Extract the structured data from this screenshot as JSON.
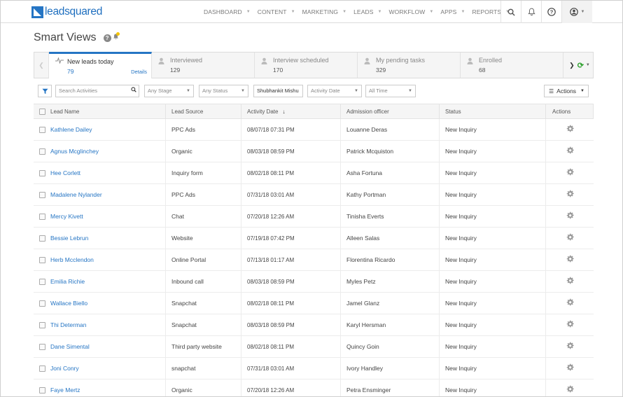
{
  "brand": {
    "logo_text": "leadsquared"
  },
  "nav": {
    "items": [
      "DASHBOARD",
      "CONTENT",
      "MARKETING",
      "LEADS",
      "WORKFLOW",
      "APPS",
      "REPORTS"
    ]
  },
  "page": {
    "title": "Smart Views"
  },
  "tabs": [
    {
      "label": "New leads today",
      "count": "79",
      "details": "Details",
      "active": true
    },
    {
      "label": "Interviewed",
      "count": "129"
    },
    {
      "label": "Interview scheduled",
      "count": "170"
    },
    {
      "label": "My pending tasks",
      "count": "329"
    },
    {
      "label": "Enrolled",
      "count": "68"
    }
  ],
  "filters": {
    "search_placeholder": "Search Activities",
    "stage": "Any Stage",
    "status": "Any Status",
    "owner": "Shubhankit Mishu",
    "date_field": "Activity Date",
    "time_range": "All Time",
    "actions_label": "Actions"
  },
  "table": {
    "columns": [
      "Lead Name",
      "Lead Source",
      "Activity Date",
      "Admission officer",
      "Status",
      "Actions"
    ],
    "rows": [
      {
        "name": "Kathlene Dailey",
        "source": "PPC Ads",
        "date": "08/07/18 07:31 PM",
        "officer": "Louanne Deras",
        "status": "New Inquiry"
      },
      {
        "name": "Agnus Mcglinchey",
        "source": "Organic",
        "date": "08/03/18 08:59 PM",
        "officer": "Patrick Mcquiston",
        "status": "New Inquiry"
      },
      {
        "name": "Hee Corlett",
        "source": "Inquiry form",
        "date": "08/02/18 08:11 PM",
        "officer": "Asha Fortuna",
        "status": "New Inquiry"
      },
      {
        "name": "Madalene Nylander",
        "source": "PPC Ads",
        "date": "07/31/18 03:01 AM",
        "officer": "Kathy Portman",
        "status": "New Inquiry"
      },
      {
        "name": "Mercy Kivett",
        "source": "Chat",
        "date": "07/20/18 12:26 AM",
        "officer": "Tinisha Everts",
        "status": "New Inquiry"
      },
      {
        "name": "Bessie Lebrun",
        "source": "Website",
        "date": "07/19/18 07:42 PM",
        "officer": "Alleen Salas",
        "status": "New Inquiry"
      },
      {
        "name": "Herb Mcclendon",
        "source": "Online Portal",
        "date": "07/13/18 01:17 AM",
        "officer": "Florentina Ricardo",
        "status": "New Inquiry"
      },
      {
        "name": "Emilia Richie",
        "source": "Inbound call",
        "date": "08/03/18 08:59 PM",
        "officer": "Myles Petz",
        "status": "New Inquiry"
      },
      {
        "name": "Wallace Biello",
        "source": "Snapchat",
        "date": "08/02/18 08:11 PM",
        "officer": "Jamel Glanz",
        "status": "New Inquiry"
      },
      {
        "name": "Thi Determan",
        "source": "Snapchat",
        "date": "08/03/18 08:59 PM",
        "officer": "Karyl Hersman",
        "status": "New Inquiry"
      },
      {
        "name": "Dane Simental",
        "source": "Third party website",
        "date": "08/02/18 08:11 PM",
        "officer": "Quincy Goin",
        "status": "New Inquiry"
      },
      {
        "name": "Joni Conry",
        "source": "snapchat",
        "date": "07/31/18 03:01 AM",
        "officer": "Ivory Handley",
        "status": "New Inquiry"
      },
      {
        "name": "Faye Mertz",
        "source": "Organic",
        "date": "07/20/18 12:26 AM",
        "officer": "Petra Ensminger",
        "status": "New Inquiry"
      }
    ]
  },
  "colors": {
    "accent": "#2575c4",
    "refresh": "#2ca02c",
    "notify": "#f5c400"
  }
}
